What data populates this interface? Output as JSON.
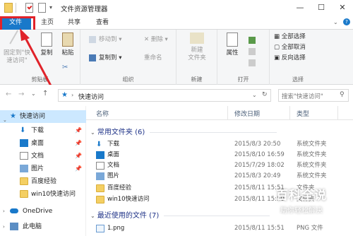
{
  "window": {
    "title": "文件资源管理器"
  },
  "tabs": [
    "文件",
    "主页",
    "共享",
    "查看"
  ],
  "ribbon": {
    "clipboard": {
      "pin_label": "固定到\"快\n速访问\"",
      "copy": "复制",
      "paste": "粘贴",
      "group": "剪贴板"
    },
    "organize": {
      "move_to": "移动到",
      "copy_to": "复制到",
      "delete": "删除",
      "rename": "重命名",
      "group": "组织"
    },
    "new": {
      "new_folder": "新建\n文件夹",
      "group": "新建"
    },
    "open": {
      "properties": "属性",
      "group": "打开"
    },
    "select": {
      "select_all": "全部选择",
      "select_none": "全部取消",
      "invert": "反向选择",
      "group": "选择"
    }
  },
  "address": {
    "path": "快速访问",
    "search_placeholder": "搜索\"快速访问\""
  },
  "nav": {
    "quick_access": "快速访问",
    "items": [
      "下载",
      "桌面",
      "文档",
      "图片",
      "百度经验",
      "win10快速访问"
    ],
    "onedrive": "OneDrive",
    "this_pc": "此电脑"
  },
  "columns": {
    "name": "名称",
    "date": "修改日期",
    "type": "类型"
  },
  "groups": {
    "frequent": "常用文件夹 (6)",
    "recent": "最近使用的文件 (7)"
  },
  "frequent": [
    {
      "name": "下载",
      "date": "2015/8/3 20:50",
      "type": "系统文件夹",
      "icon": "download-icon"
    },
    {
      "name": "桌面",
      "date": "2015/8/10 16:59",
      "type": "系统文件夹",
      "icon": "desktop-icon"
    },
    {
      "name": "文档",
      "date": "2015/7/29 18:02",
      "type": "系统文件夹",
      "icon": "document-icon"
    },
    {
      "name": "图片",
      "date": "2015/8/3 20:49",
      "type": "系统文件夹",
      "icon": "picture-icon"
    },
    {
      "name": "百度经验",
      "date": "2015/8/11 15:51",
      "type": "文件夹",
      "icon": "folder-icon"
    },
    {
      "name": "win10快速访问",
      "date": "2015/8/11 15:50",
      "type": "文件夹",
      "icon": "folder-icon"
    }
  ],
  "recent": [
    {
      "name": "1.png",
      "date": "2015/8/11 15:51",
      "type": "PNG 文件",
      "icon": "image-file-icon"
    }
  ],
  "watermark": {
    "title": "百科全说",
    "subtitle": "助你轻松解决"
  },
  "colors": {
    "file_tab": "#1979ca",
    "highlight": "#e0232a",
    "folder": "#f4cf63"
  }
}
